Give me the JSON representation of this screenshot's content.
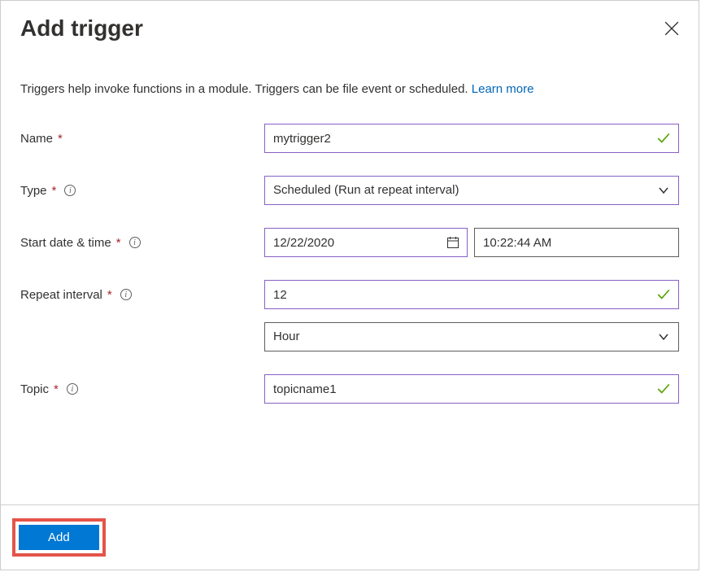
{
  "header": {
    "title": "Add trigger"
  },
  "description": {
    "text": "Triggers help invoke functions in a module. Triggers can be file event or scheduled. ",
    "learn_more_label": "Learn more"
  },
  "fields": {
    "name": {
      "label": "Name",
      "value": "mytrigger2"
    },
    "type": {
      "label": "Type",
      "value": "Scheduled (Run at repeat interval)"
    },
    "start_datetime": {
      "label": "Start date & time",
      "date_value": "12/22/2020",
      "time_value": "10:22:44 AM"
    },
    "repeat_interval": {
      "label": "Repeat interval",
      "value": "12",
      "unit": "Hour"
    },
    "topic": {
      "label": "Topic",
      "value": "topicname1"
    }
  },
  "footer": {
    "add_label": "Add"
  }
}
